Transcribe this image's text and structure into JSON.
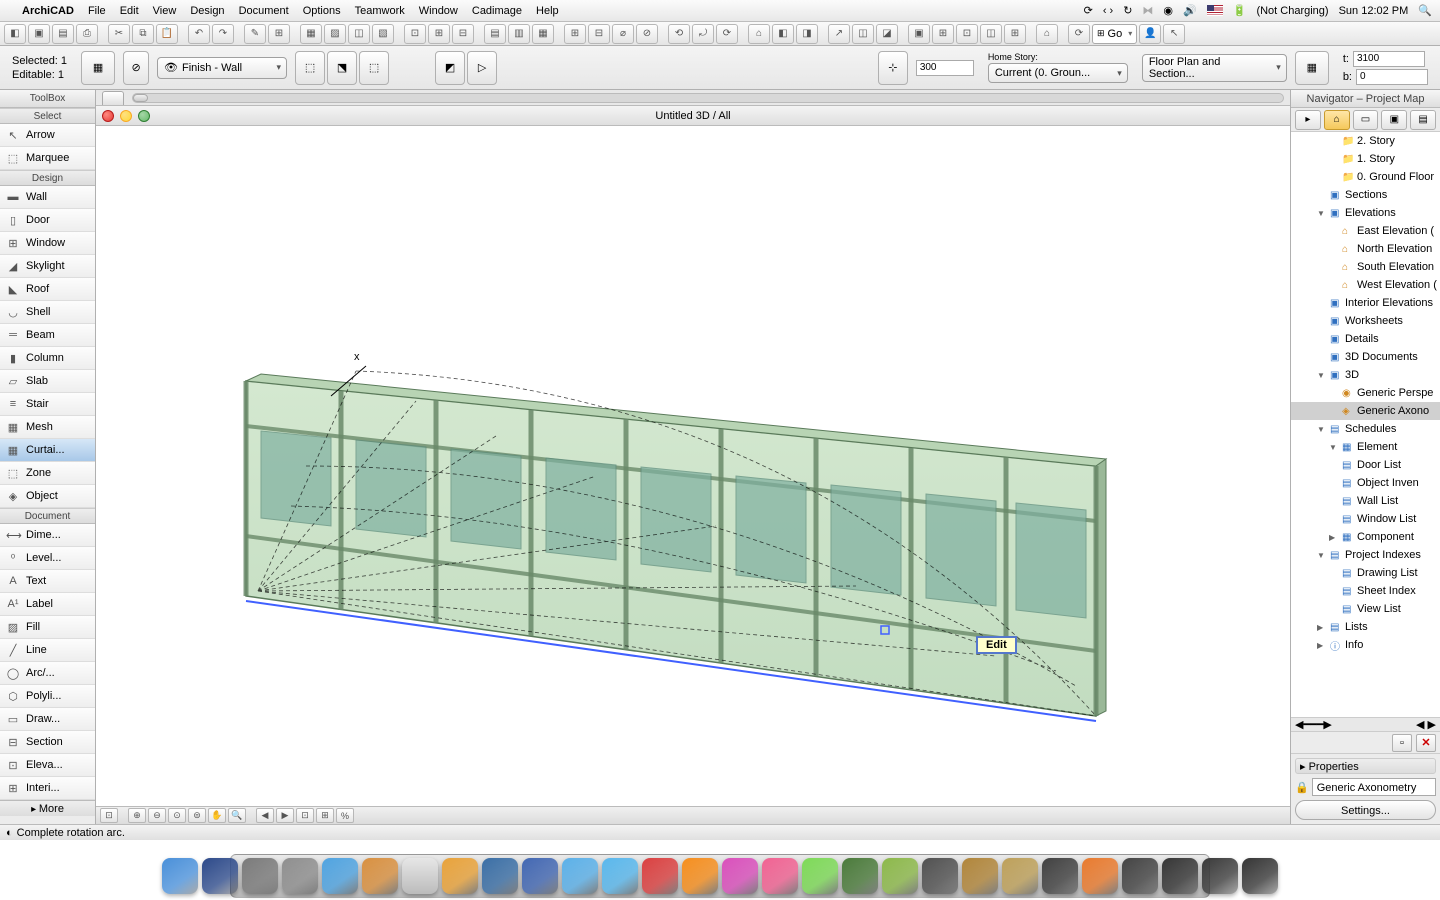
{
  "menubar": {
    "app": "ArchiCAD",
    "items": [
      "File",
      "Edit",
      "View",
      "Design",
      "Document",
      "Options",
      "Teamwork",
      "Window",
      "Cadimage",
      "Help"
    ],
    "battery": "(Not Charging)",
    "clock": "Sun 12:02 PM"
  },
  "toolbar_icons": [
    "◧",
    "▣",
    "▤",
    "⎙",
    "",
    "✂",
    "⧉",
    "📋",
    "",
    "↶",
    "↷",
    "",
    "✎",
    "⊞",
    "",
    "▦",
    "▨",
    "◫",
    "▧",
    "",
    "⊡",
    "⊞",
    "⊟",
    "",
    "▤",
    "▥",
    "▦",
    "",
    "⊞",
    "⊟",
    "⌀",
    "⊘",
    "",
    "⟲",
    "⤾",
    "⟳",
    "",
    "⌂",
    "◧",
    "◨",
    "",
    "↗",
    "◫",
    "◪",
    "",
    "▣",
    "⊞",
    "⊡",
    "◫",
    "⊞",
    "",
    "⌂",
    "",
    "⟳"
  ],
  "go_label": "Go",
  "info": {
    "selected": "Selected: 1",
    "editable": "Editable: 1",
    "layer": "Finish - Wall",
    "num_field": "300",
    "home_label": "Home Story:",
    "home_value": "Current (0. Groun...",
    "floorplan": "Floor Plan and Section...",
    "t_label": "t:",
    "t_val": "3100",
    "b_label": "b:",
    "b_val": "0"
  },
  "toolbox": {
    "title": "ToolBox",
    "select": "Select",
    "arrow": "Arrow",
    "marquee": "Marquee",
    "design": "Design",
    "design_tools": [
      {
        "ic": "▬",
        "l": "Wall"
      },
      {
        "ic": "▯",
        "l": "Door"
      },
      {
        "ic": "⊞",
        "l": "Window"
      },
      {
        "ic": "◢",
        "l": "Skylight"
      },
      {
        "ic": "◣",
        "l": "Roof"
      },
      {
        "ic": "◡",
        "l": "Shell"
      },
      {
        "ic": "═",
        "l": "Beam"
      },
      {
        "ic": "▮",
        "l": "Column"
      },
      {
        "ic": "▱",
        "l": "Slab"
      },
      {
        "ic": "≡",
        "l": "Stair"
      },
      {
        "ic": "▦",
        "l": "Mesh"
      },
      {
        "ic": "▦",
        "l": "Curtai...",
        "sel": true
      },
      {
        "ic": "⬚",
        "l": "Zone"
      },
      {
        "ic": "◈",
        "l": "Object"
      }
    ],
    "document": "Document",
    "doc_tools": [
      {
        "ic": "⟷",
        "l": "Dime..."
      },
      {
        "ic": "⁰",
        "l": "Level..."
      },
      {
        "ic": "A",
        "l": "Text"
      },
      {
        "ic": "A¹",
        "l": "Label"
      },
      {
        "ic": "▨",
        "l": "Fill"
      },
      {
        "ic": "╱",
        "l": "Line"
      },
      {
        "ic": "◯",
        "l": "Arc/..."
      },
      {
        "ic": "⬡",
        "l": "Polyli..."
      },
      {
        "ic": "▭",
        "l": "Draw..."
      },
      {
        "ic": "⊟",
        "l": "Section"
      },
      {
        "ic": "⊡",
        "l": "Eleva..."
      },
      {
        "ic": "⊞",
        "l": "Interi..."
      }
    ],
    "more": "More"
  },
  "view": {
    "title": "Untitled 3D / All",
    "edit_badge": "Edit",
    "x_label": "x"
  },
  "navigator": {
    "title": "Navigator – Project Map",
    "tree": [
      {
        "ind": 3,
        "ic": "📁",
        "cls": "folder",
        "l": "2. Story"
      },
      {
        "ind": 3,
        "ic": "📁",
        "cls": "folder",
        "l": "1. Story"
      },
      {
        "ind": 3,
        "ic": "📁",
        "cls": "folder",
        "l": "0. Ground Floor"
      },
      {
        "ind": 2,
        "ic": "▣",
        "cls": "doc",
        "l": "Sections"
      },
      {
        "ind": 2,
        "ic": "▣",
        "cls": "doc",
        "l": "Elevations",
        "arr": "▼"
      },
      {
        "ind": 3,
        "ic": "⌂",
        "cls": "elev",
        "l": "East Elevation ("
      },
      {
        "ind": 3,
        "ic": "⌂",
        "cls": "elev",
        "l": "North Elevation"
      },
      {
        "ind": 3,
        "ic": "⌂",
        "cls": "elev",
        "l": "South Elevation"
      },
      {
        "ind": 3,
        "ic": "⌂",
        "cls": "elev",
        "l": "West Elevation ("
      },
      {
        "ind": 2,
        "ic": "▣",
        "cls": "doc",
        "l": "Interior Elevations"
      },
      {
        "ind": 2,
        "ic": "▣",
        "cls": "doc",
        "l": "Worksheets"
      },
      {
        "ind": 2,
        "ic": "▣",
        "cls": "doc",
        "l": "Details"
      },
      {
        "ind": 2,
        "ic": "▣",
        "cls": "doc",
        "l": "3D Documents"
      },
      {
        "ind": 2,
        "ic": "▣",
        "cls": "doc",
        "l": "3D",
        "arr": "▼"
      },
      {
        "ind": 3,
        "ic": "◉",
        "cls": "cube",
        "l": "Generic Perspe"
      },
      {
        "ind": 3,
        "ic": "◈",
        "cls": "cube",
        "l": "Generic Axono",
        "sel": true
      },
      {
        "ind": 2,
        "ic": "▤",
        "cls": "doc",
        "l": "Schedules",
        "arr": "▼"
      },
      {
        "ind": 3,
        "ic": "▦",
        "cls": "doc",
        "l": "Element",
        "arr": "▼"
      },
      {
        "ind": 3,
        "ic": "▤",
        "cls": "doc",
        "l": "  Door List"
      },
      {
        "ind": 3,
        "ic": "▤",
        "cls": "doc",
        "l": "  Object Inven"
      },
      {
        "ind": 3,
        "ic": "▤",
        "cls": "doc",
        "l": "  Wall List"
      },
      {
        "ind": 3,
        "ic": "▤",
        "cls": "doc",
        "l": "  Window List"
      },
      {
        "ind": 3,
        "ic": "▦",
        "cls": "doc",
        "l": "Component",
        "arr": "▶"
      },
      {
        "ind": 2,
        "ic": "▤",
        "cls": "doc",
        "l": "Project Indexes",
        "arr": "▼"
      },
      {
        "ind": 3,
        "ic": "▤",
        "cls": "doc",
        "l": "Drawing List"
      },
      {
        "ind": 3,
        "ic": "▤",
        "cls": "doc",
        "l": "Sheet Index"
      },
      {
        "ind": 3,
        "ic": "▤",
        "cls": "doc",
        "l": "View List"
      },
      {
        "ind": 2,
        "ic": "▤",
        "cls": "doc",
        "l": "Lists",
        "arr": "▶"
      },
      {
        "ind": 2,
        "ic": "ⓘ",
        "cls": "doc",
        "l": "Info",
        "arr": "▶"
      }
    ],
    "properties_label": "Properties",
    "prop_value": "Generic Axonometry",
    "settings": "Settings..."
  },
  "status": "Complete rotation arc.",
  "dock_colors": [
    "#4a90d9",
    "#2d4a8a",
    "#7a7a7a",
    "#8e8e8e",
    "#4fa3e0",
    "#d89040",
    "#555",
    "#e8a23a",
    "#3a6ea5",
    "#4267b2",
    "#5bb0e8",
    "#59b7ec",
    "#da4040",
    "#f58e1e",
    "#d94fbb",
    "#f06292",
    "#7dd957",
    "#4a7a3a",
    "#8cb84a",
    "#505050",
    "#b0853a",
    "#bda05a",
    "#404040",
    "#e87a2e",
    "#434343",
    "#353535",
    "#3a3a3a",
    "#353535"
  ]
}
